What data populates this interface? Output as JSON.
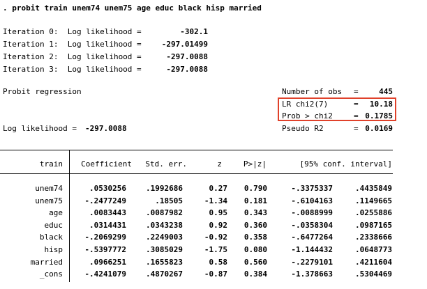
{
  "command": ". probit train unem74 unem75 age educ black hisp married",
  "iterations": [
    {
      "label": "Iteration 0:  Log likelihood =",
      "value": "-302.1"
    },
    {
      "label": "Iteration 1:  Log likelihood =",
      "value": "-297.01499"
    },
    {
      "label": "Iteration 2:  Log likelihood =",
      "value": "-297.0088"
    },
    {
      "label": "Iteration 3:  Log likelihood =",
      "value": "-297.0088"
    }
  ],
  "model_title": "Probit regression",
  "stats": [
    {
      "label": "Number of obs",
      "eq": "=",
      "value": "445"
    },
    {
      "label": "LR chi2(7)",
      "eq": "=",
      "value": "10.18"
    },
    {
      "label": "Prob > chi2",
      "eq": "=",
      "value": "0.1785"
    },
    {
      "label": "Pseudo R2",
      "eq": "=",
      "value": "0.0169"
    }
  ],
  "log_likelihood_label": "Log likelihood =",
  "log_likelihood_value": "-297.0088",
  "highlight_color": "#e0412a",
  "table": {
    "depvar": "train",
    "headers": [
      "Coefficient",
      "Std. err.",
      "z",
      "P>|z|",
      "[95% conf. interval]"
    ],
    "rows": [
      {
        "name": "unem74",
        "coef": ".0530256",
        "se": ".1992686",
        "z": "0.27",
        "p": "0.790",
        "lo": "-.3375337",
        "hi": ".4435849"
      },
      {
        "name": "unem75",
        "coef": "-.2477249",
        "se": ".18505",
        "z": "-1.34",
        "p": "0.181",
        "lo": "-.6104163",
        "hi": ".1149665"
      },
      {
        "name": "age",
        "coef": ".0083443",
        "se": ".0087982",
        "z": "0.95",
        "p": "0.343",
        "lo": "-.0088999",
        "hi": ".0255886"
      },
      {
        "name": "educ",
        "coef": ".0314431",
        "se": ".0343238",
        "z": "0.92",
        "p": "0.360",
        "lo": "-.0358304",
        "hi": ".0987165"
      },
      {
        "name": "black",
        "coef": "-.2069299",
        "se": ".2249003",
        "z": "-0.92",
        "p": "0.358",
        "lo": "-.6477264",
        "hi": ".2338666"
      },
      {
        "name": "hisp",
        "coef": "-.5397772",
        "se": ".3085029",
        "z": "-1.75",
        "p": "0.080",
        "lo": "-1.144432",
        "hi": ".0648773"
      },
      {
        "name": "married",
        "coef": ".0966251",
        "se": ".1655823",
        "z": "0.58",
        "p": "0.560",
        "lo": "-.2279101",
        "hi": ".4211604"
      },
      {
        "name": "_cons",
        "coef": "-.4241079",
        "se": ".4870267",
        "z": "-0.87",
        "p": "0.384",
        "lo": "-1.378663",
        "hi": ".5304469"
      }
    ]
  }
}
